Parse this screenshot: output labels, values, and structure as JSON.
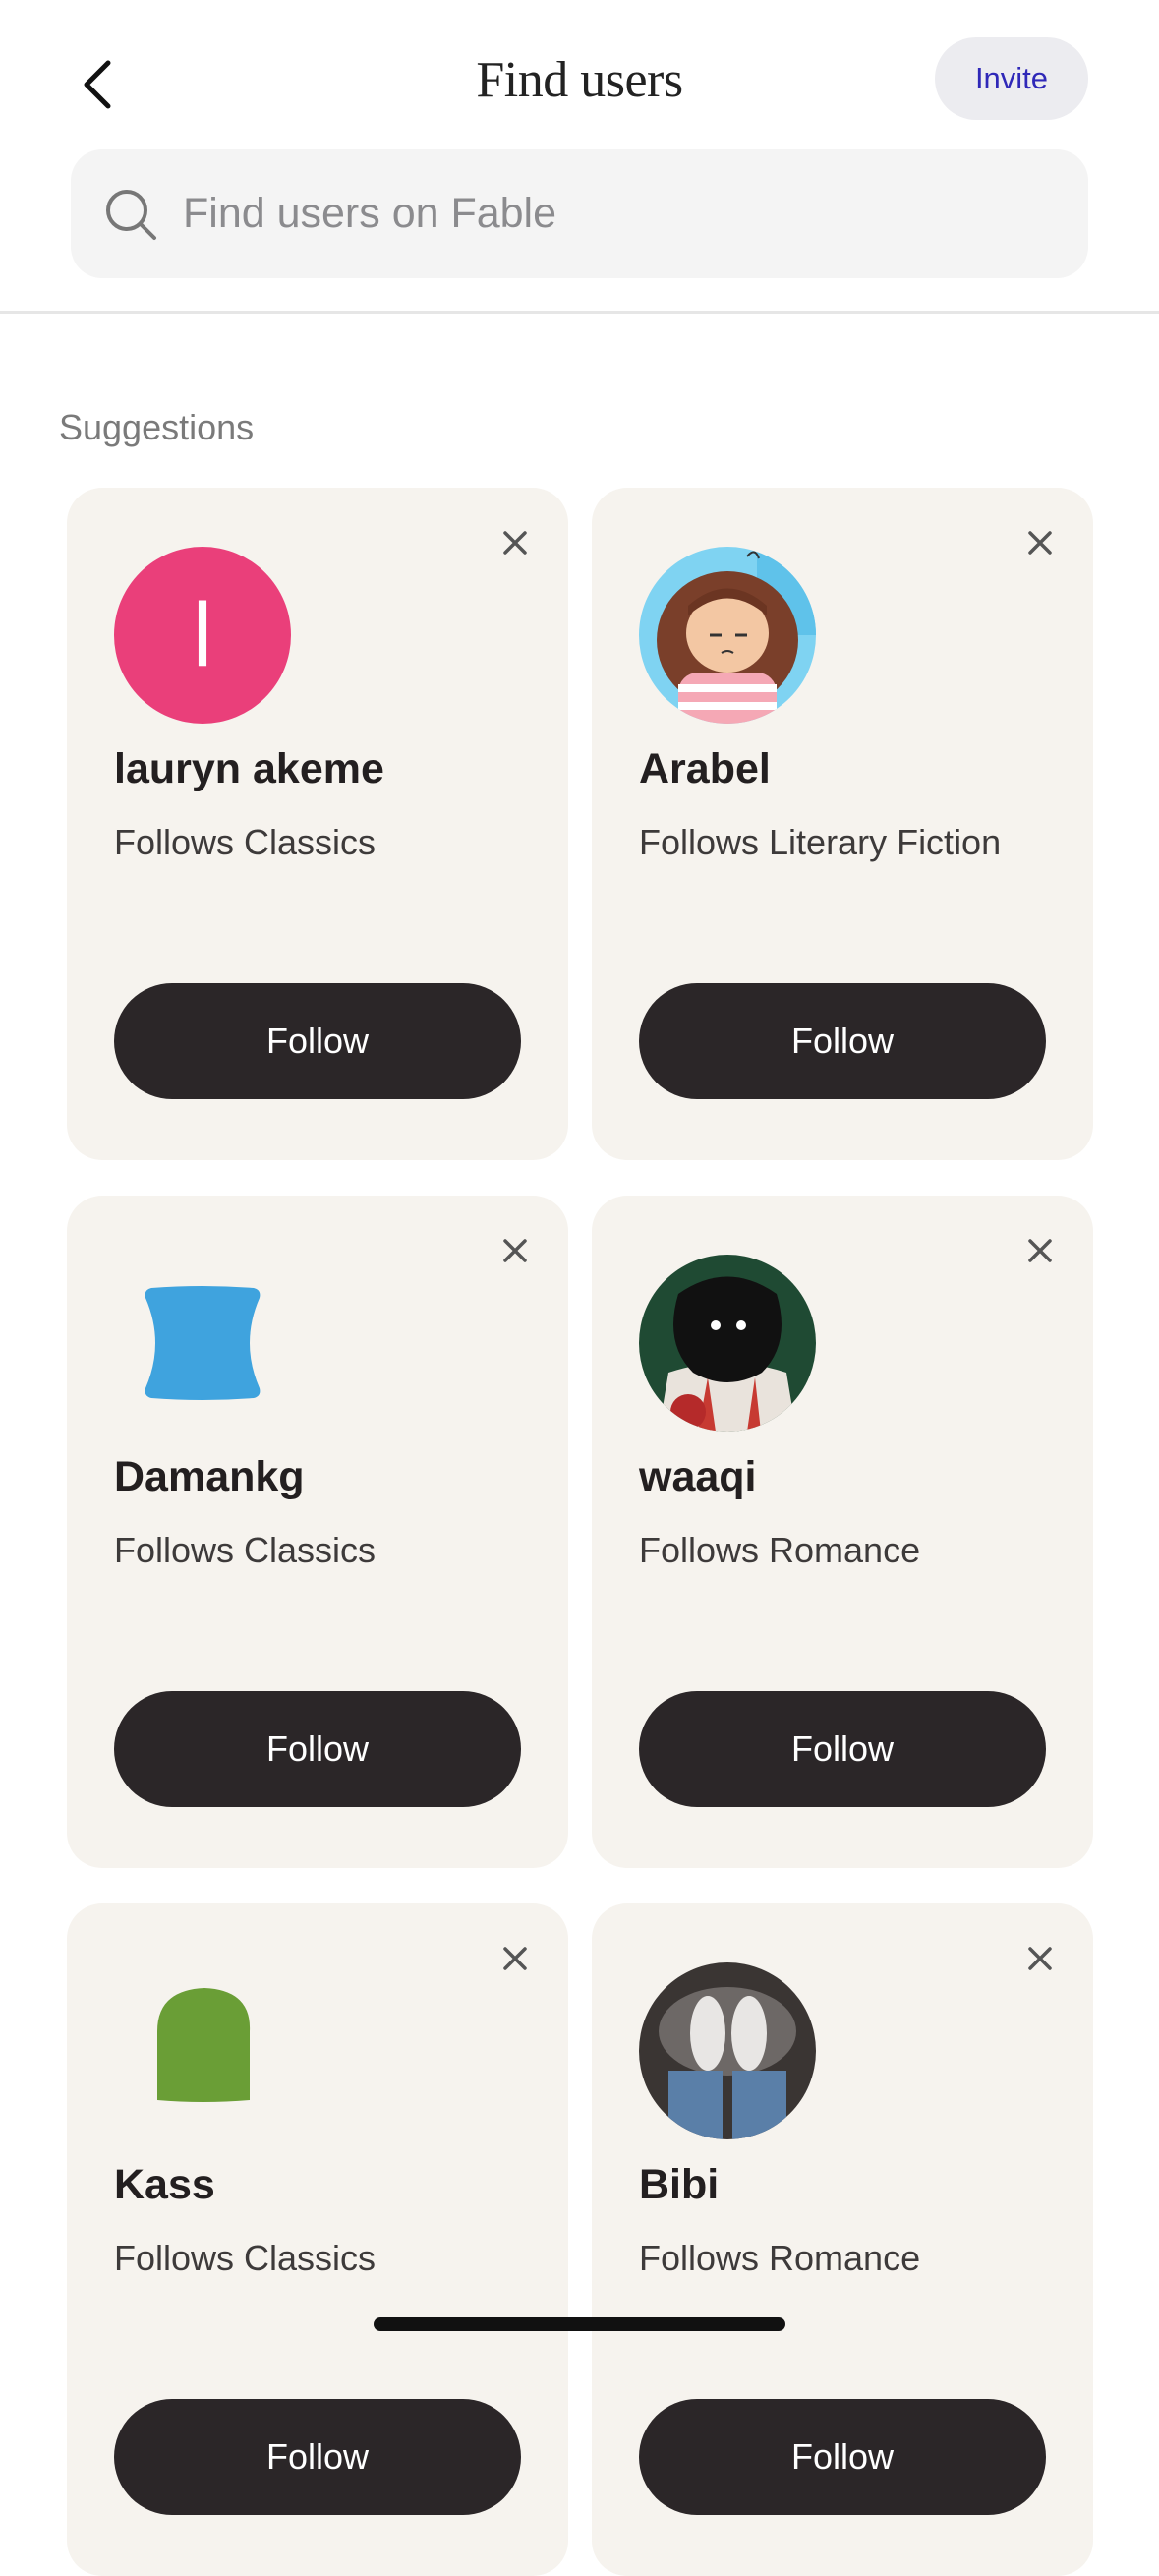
{
  "header": {
    "title": "Find users",
    "invite_label": "Invite"
  },
  "search": {
    "placeholder": "Find users on Fable"
  },
  "section_label": "Suggestions",
  "suggestions": [
    {
      "name": "lauryn akeme",
      "subtitle": "Follows Classics",
      "follow_label": "Follow",
      "avatar": {
        "type": "initial",
        "initial": "l",
        "color": "#ea3f7a"
      }
    },
    {
      "name": "Arabel",
      "subtitle": "Follows Literary Fiction",
      "follow_label": "Follow",
      "avatar": {
        "type": "photo",
        "description_icon": "cartoon-girl-avatar"
      }
    },
    {
      "name": "Damankg",
      "subtitle": "Follows Classics",
      "follow_label": "Follow",
      "avatar": {
        "type": "shape",
        "color": "#3fa3de"
      }
    },
    {
      "name": "waaqi",
      "subtitle": "Follows Romance",
      "follow_label": "Follow",
      "avatar": {
        "type": "photo",
        "description_icon": "anime-character-avatar"
      }
    },
    {
      "name": "Kass",
      "subtitle": "Follows Classics",
      "follow_label": "Follow",
      "avatar": {
        "type": "shape",
        "color": "#6a9e36"
      }
    },
    {
      "name": "Bibi",
      "subtitle": "Follows Romance",
      "follow_label": "Follow",
      "avatar": {
        "type": "photo",
        "description_icon": "sneakers-photo-avatar"
      }
    }
  ],
  "colors": {
    "card_bg": "#f6f3ee",
    "button_bg": "#2b2628",
    "invite_text": "#2f28b8"
  }
}
